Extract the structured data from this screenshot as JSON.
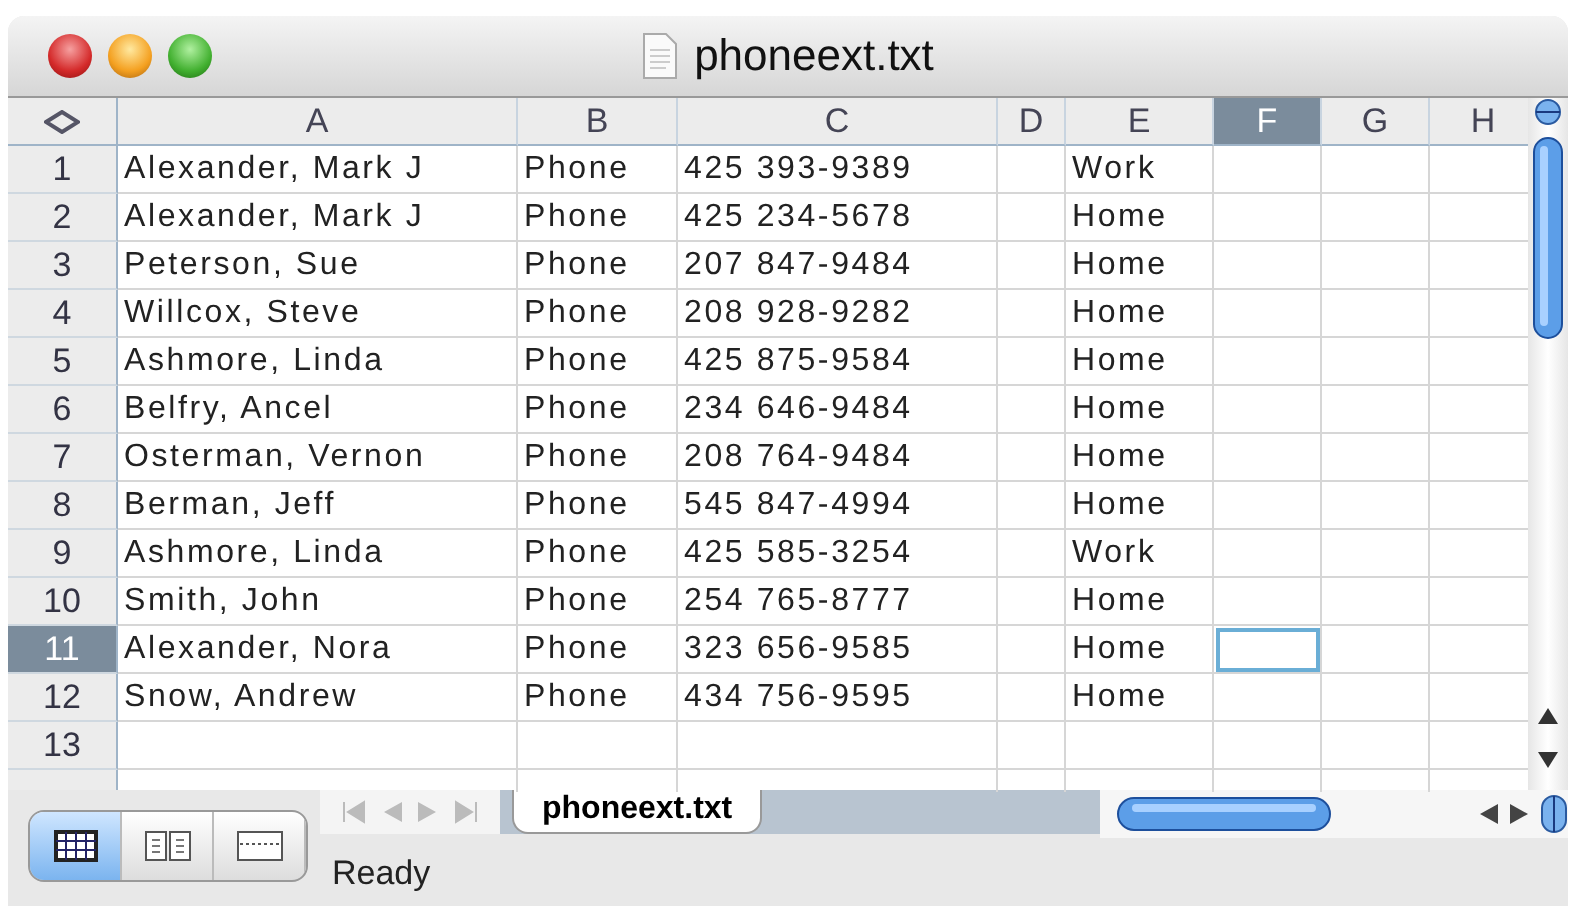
{
  "window": {
    "title": "phoneext.txt"
  },
  "columns": [
    {
      "label": "A",
      "selected": false
    },
    {
      "label": "B",
      "selected": false
    },
    {
      "label": "C",
      "selected": false
    },
    {
      "label": "D",
      "selected": false
    },
    {
      "label": "E",
      "selected": false
    },
    {
      "label": "F",
      "selected": true
    },
    {
      "label": "G",
      "selected": false
    },
    {
      "label": "H",
      "selected": false
    }
  ],
  "rows": [
    {
      "number": "1",
      "selected": false,
      "cells": {
        "A": "Alexander, Mark J",
        "B": "Phone",
        "C": "425 393-9389",
        "E": "Work"
      }
    },
    {
      "number": "2",
      "selected": false,
      "cells": {
        "A": "Alexander, Mark J",
        "B": "Phone",
        "C": "425 234-5678",
        "E": "Home"
      }
    },
    {
      "number": "3",
      "selected": false,
      "cells": {
        "A": "Peterson, Sue",
        "B": "Phone",
        "C": "207 847-9484",
        "E": "Home"
      }
    },
    {
      "number": "4",
      "selected": false,
      "cells": {
        "A": "Willcox, Steve",
        "B": "Phone",
        "C": "208 928-9282",
        "E": "Home"
      }
    },
    {
      "number": "5",
      "selected": false,
      "cells": {
        "A": "Ashmore, Linda",
        "B": "Phone",
        "C": "425 875-9584",
        "E": "Home"
      }
    },
    {
      "number": "6",
      "selected": false,
      "cells": {
        "A": "Belfry, Ancel",
        "B": "Phone",
        "C": "234 646-9484",
        "E": "Home"
      }
    },
    {
      "number": "7",
      "selected": false,
      "cells": {
        "A": "Osterman, Vernon",
        "B": "Phone",
        "C": "208 764-9484",
        "E": "Home"
      }
    },
    {
      "number": "8",
      "selected": false,
      "cells": {
        "A": "Berman, Jeff",
        "B": "Phone",
        "C": "545 847-4994",
        "E": "Home"
      }
    },
    {
      "number": "9",
      "selected": false,
      "cells": {
        "A": "Ashmore, Linda",
        "B": "Phone",
        "C": "425 585-3254",
        "E": "Work"
      }
    },
    {
      "number": "10",
      "selected": false,
      "cells": {
        "A": "Smith, John",
        "B": "Phone",
        "C": "254 765-8777",
        "E": "Home"
      }
    },
    {
      "number": "11",
      "selected": true,
      "cells": {
        "A": "Alexander, Nora",
        "B": "Phone",
        "C": "323 656-9585",
        "E": "Home"
      }
    },
    {
      "number": "12",
      "selected": false,
      "cells": {
        "A": "Snow, Andrew",
        "B": "Phone",
        "C": "434 756-9595",
        "E": "Home"
      }
    },
    {
      "number": "13",
      "selected": false,
      "cells": {}
    }
  ],
  "view_buttons": [
    {
      "kind": "normal",
      "selected": true
    },
    {
      "kind": "layout",
      "selected": false
    },
    {
      "kind": "page-break",
      "selected": false
    }
  ],
  "sheet_tabs": [
    {
      "label": "phoneext.txt",
      "selected": true
    }
  ],
  "status_bar": {
    "text": "Ready"
  }
}
